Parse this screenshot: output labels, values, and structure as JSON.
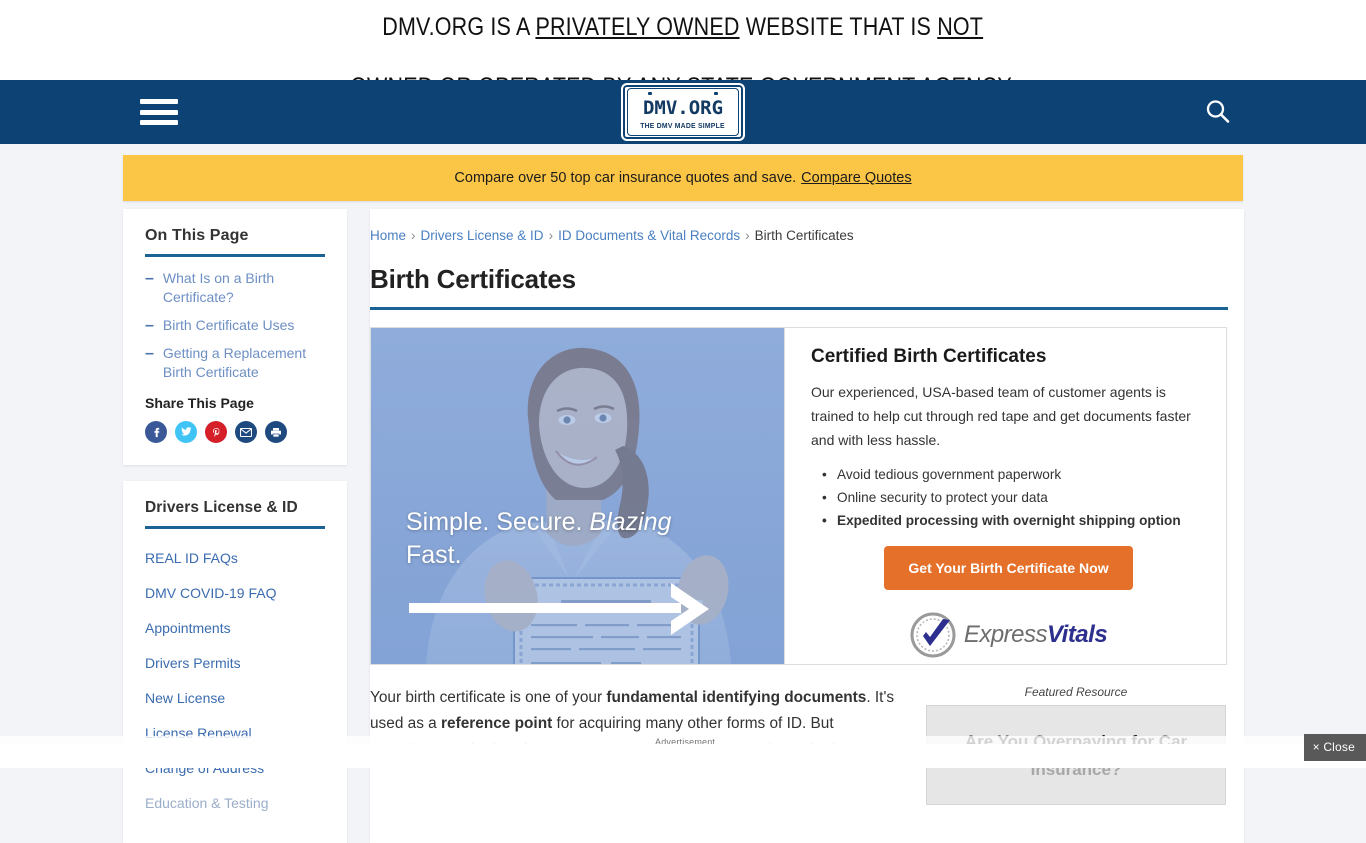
{
  "disclaimer": {
    "line1_pre": "DMV.ORG IS A ",
    "line1_em1": "PRIVATELY OWNED",
    "line1_mid": " WEBSITE THAT IS ",
    "line1_em2": "NOT",
    "line2": "OWNED OR OPERATED BY ANY STATE GOVERNMENT AGENCY."
  },
  "header": {
    "menu_icon": "hamburger-icon",
    "logo_main": "DMV.ORG",
    "logo_sub": "THE DMV MADE SIMPLE",
    "search_icon": "search-icon",
    "background_color": "#0d4274"
  },
  "promo": {
    "text": "Compare over 50 top car insurance quotes and save.",
    "link": "Compare Quotes",
    "background_color": "#fbc546"
  },
  "sidebar": {
    "on_this_page": {
      "title": "On This Page",
      "items": [
        {
          "label": "What Is on a Birth Certificate?"
        },
        {
          "label": "Birth Certificate Uses"
        },
        {
          "label": "Getting a Replacement Birth Certificate"
        }
      ],
      "share_title": "Share This Page",
      "share_icons": [
        {
          "name": "facebook-icon",
          "glyph": "f",
          "color": "#3b5998"
        },
        {
          "name": "twitter-icon",
          "glyph": "t",
          "color": "#40c4f5"
        },
        {
          "name": "pinterest-icon",
          "glyph": "P",
          "color": "#d51f29"
        },
        {
          "name": "email-icon",
          "glyph": "✉",
          "color": "#1f4a80"
        },
        {
          "name": "print-icon",
          "glyph": "⎙",
          "color": "#1f4a80"
        }
      ]
    },
    "nav": {
      "title": "Drivers License & ID",
      "items": [
        {
          "label": "REAL ID FAQs",
          "dim": false
        },
        {
          "label": "DMV COVID-19 FAQ",
          "dim": false
        },
        {
          "label": "Appointments",
          "dim": false
        },
        {
          "label": "Drivers Permits",
          "dim": false
        },
        {
          "label": "New License",
          "dim": false
        },
        {
          "label": "License Renewal",
          "dim": false
        },
        {
          "label": "Change of Address",
          "dim": false
        },
        {
          "label": "Education & Testing",
          "dim": true
        }
      ]
    }
  },
  "main": {
    "breadcrumb": [
      {
        "label": "Home",
        "link": true
      },
      {
        "label": "Drivers License & ID",
        "link": true
      },
      {
        "label": "ID Documents & Vital Records",
        "link": true
      },
      {
        "label": "Birth Certificates",
        "link": false
      }
    ],
    "separator": "›",
    "page_title": "Birth Certificates",
    "ad": {
      "hero_line1": "Simple. Secure. ",
      "hero_em": "Blazing",
      "hero_line2": "Fast.",
      "arrow_icon": "right-arrow-icon",
      "heading": "Certified Birth Certificates",
      "paragraph": "Our experienced, USA-based team of customer agents is trained to help cut through red tape and get documents faster and with less hassle.",
      "bullets": [
        {
          "text": "Avoid tedious government paperwork",
          "bold": false
        },
        {
          "text": "Online security to protect your data",
          "bold": false
        },
        {
          "text": "Expedited processing with overnight shipping option",
          "bold": true
        }
      ],
      "cta_label": "Get Your Birth Certificate Now",
      "cta_color": "#e4702a",
      "brand_word1": "Express",
      "brand_word2": "Vitals",
      "brand_icon": "checkmark-seal-icon"
    },
    "body": {
      "seg1": "Your birth certificate is one of your ",
      "seg2_bold": "fundamental identifying documents",
      "seg3": ". It's used as a ",
      "seg4_bold": "reference point",
      "seg5": " for acquiring many other forms of ID. But ",
      "seg6_fade": "sometimes—whether due to a move, a natural disaster, or just a bad"
    },
    "featured": {
      "label": "Featured Resource",
      "heading_line1": "Are You Overpaying for Car",
      "heading_line2": "Insurance?"
    }
  },
  "overlay": {
    "advertisement_label": "Advertisement",
    "close_label": "× Close"
  }
}
